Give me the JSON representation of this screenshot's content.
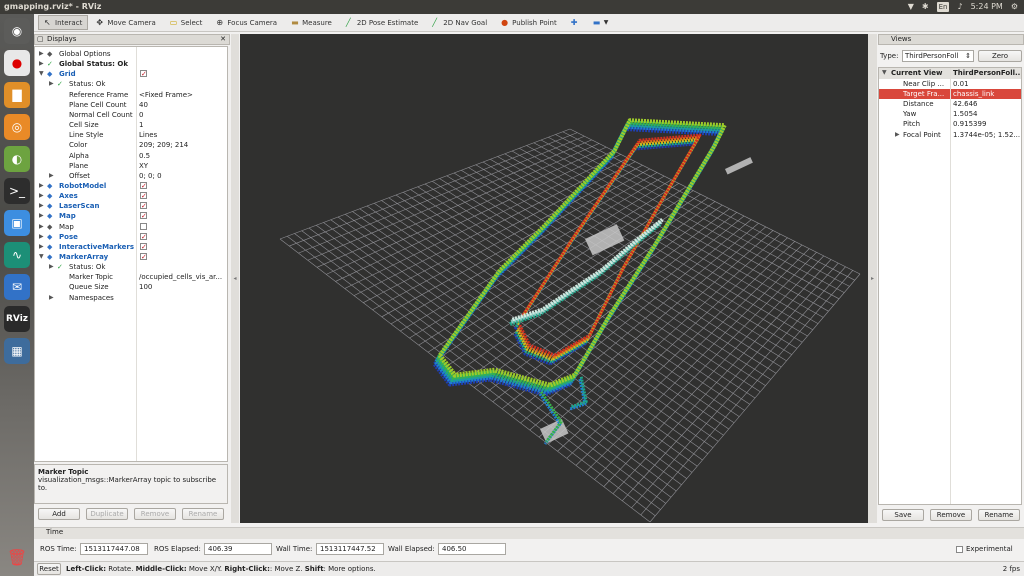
{
  "window": {
    "title": "gmapping.rviz* - RViz"
  },
  "tray": {
    "keyboard": "En",
    "time": "5:24 PM"
  },
  "toolbar": {
    "tools": [
      {
        "label": "Interact",
        "icon": "cursor-icon"
      },
      {
        "label": "Move Camera",
        "icon": "move-icon"
      },
      {
        "label": "Select",
        "icon": "select-icon"
      },
      {
        "label": "Focus Camera",
        "icon": "focus-icon"
      },
      {
        "label": "Measure",
        "icon": "ruler-icon"
      },
      {
        "label": "2D Pose Estimate",
        "icon": "green-arrow-icon"
      },
      {
        "label": "2D Nav Goal",
        "icon": "green-arrow-icon"
      },
      {
        "label": "Publish Point",
        "icon": "pin-icon"
      }
    ]
  },
  "displays": {
    "title": "Displays",
    "rows": [
      {
        "key": "Global Options",
        "val": "",
        "indent": 0,
        "style": "normal",
        "check": null,
        "arrow": "▶"
      },
      {
        "key": "Global Status: Ok",
        "val": "",
        "indent": 0,
        "style": "bold",
        "check": null,
        "arrow": "▶"
      },
      {
        "key": "Grid",
        "val": "",
        "indent": 0,
        "style": "blue",
        "check": true,
        "arrow": "▼"
      },
      {
        "key": "Status: Ok",
        "val": "",
        "indent": 1,
        "style": "normal",
        "check": null,
        "arrow": "▶"
      },
      {
        "key": "Reference Frame",
        "val": "<Fixed Frame>",
        "indent": 1,
        "style": "normal",
        "check": null,
        "arrow": ""
      },
      {
        "key": "Plane Cell Count",
        "val": "40",
        "indent": 1,
        "style": "normal",
        "check": null,
        "arrow": ""
      },
      {
        "key": "Normal Cell Count",
        "val": "0",
        "indent": 1,
        "style": "normal",
        "check": null,
        "arrow": ""
      },
      {
        "key": "Cell Size",
        "val": "1",
        "indent": 1,
        "style": "normal",
        "check": null,
        "arrow": ""
      },
      {
        "key": "Line Style",
        "val": "Lines",
        "indent": 1,
        "style": "normal",
        "check": null,
        "arrow": ""
      },
      {
        "key": "Color",
        "val": "209; 209; 214",
        "indent": 1,
        "style": "normal",
        "check": null,
        "arrow": ""
      },
      {
        "key": "Alpha",
        "val": "0.5",
        "indent": 1,
        "style": "normal",
        "check": null,
        "arrow": ""
      },
      {
        "key": "Plane",
        "val": "XY",
        "indent": 1,
        "style": "normal",
        "check": null,
        "arrow": ""
      },
      {
        "key": "Offset",
        "val": "0; 0; 0",
        "indent": 1,
        "style": "normal",
        "check": null,
        "arrow": "▶"
      },
      {
        "key": "RobotModel",
        "val": "",
        "indent": 0,
        "style": "blue",
        "check": true,
        "arrow": "▶"
      },
      {
        "key": "Axes",
        "val": "",
        "indent": 0,
        "style": "blue",
        "check": true,
        "arrow": "▶"
      },
      {
        "key": "LaserScan",
        "val": "",
        "indent": 0,
        "style": "blue",
        "check": true,
        "arrow": "▶"
      },
      {
        "key": "Map",
        "val": "",
        "indent": 0,
        "style": "blue",
        "check": true,
        "arrow": "▶"
      },
      {
        "key": "Map",
        "val": "",
        "indent": 0,
        "style": "normal",
        "check": false,
        "arrow": "▶"
      },
      {
        "key": "Pose",
        "val": "",
        "indent": 0,
        "style": "blue",
        "check": true,
        "arrow": "▶"
      },
      {
        "key": "InteractiveMarkers",
        "val": "",
        "indent": 0,
        "style": "blue",
        "check": true,
        "arrow": "▶"
      },
      {
        "key": "MarkerArray",
        "val": "",
        "indent": 0,
        "style": "blue",
        "check": true,
        "arrow": "▼"
      },
      {
        "key": "Status: Ok",
        "val": "",
        "indent": 1,
        "style": "normal",
        "check": null,
        "arrow": "▶"
      },
      {
        "key": "Marker Topic",
        "val": "/occupied_cells_vis_ar...",
        "indent": 1,
        "style": "normal",
        "check": null,
        "arrow": ""
      },
      {
        "key": "Queue Size",
        "val": "100",
        "indent": 1,
        "style": "normal",
        "check": null,
        "arrow": ""
      },
      {
        "key": "Namespaces",
        "val": "",
        "indent": 1,
        "style": "normal",
        "check": null,
        "arrow": "▶"
      }
    ],
    "desc_title": "Marker Topic",
    "desc_text": "visualization_msgs::MarkerArray topic to subscribe to.",
    "buttons": {
      "add": "Add",
      "duplicate": "Duplicate",
      "remove": "Remove",
      "rename": "Rename"
    }
  },
  "views": {
    "title": "Views",
    "type_label": "Type:",
    "type_value": "ThirdPersonFoll",
    "zero": "Zero",
    "header_key": "Current View",
    "header_val": "ThirdPersonFoll...",
    "rows": [
      {
        "key": "Near Clip ...",
        "val": "0.01",
        "selected": false,
        "arrow": ""
      },
      {
        "key": "Target Fra...",
        "val": "chassis_link",
        "selected": true,
        "arrow": ""
      },
      {
        "key": "Distance",
        "val": "42.646",
        "selected": false,
        "arrow": ""
      },
      {
        "key": "Yaw",
        "val": "1.5054",
        "selected": false,
        "arrow": ""
      },
      {
        "key": "Pitch",
        "val": "0.915399",
        "selected": false,
        "arrow": ""
      },
      {
        "key": "Focal Point",
        "val": "1.3744e-05; 1.52...",
        "selected": false,
        "arrow": "▶"
      }
    ],
    "buttons": {
      "save": "Save",
      "remove": "Remove",
      "rename": "Rename"
    }
  },
  "time": {
    "title": "Time",
    "ros_time_label": "ROS Time:",
    "ros_time": "1513117447.08",
    "ros_elapsed_label": "ROS Elapsed:",
    "ros_elapsed": "406.39",
    "wall_time_label": "Wall Time:",
    "wall_time": "1513117447.52",
    "wall_elapsed_label": "Wall Elapsed:",
    "wall_elapsed": "406.50",
    "experimental": "Experimental"
  },
  "status": {
    "reset": "Reset",
    "left_click": "Left-Click:",
    "left_text": " Rotate. ",
    "middle_click": "Middle-Click:",
    "middle_text": " Move X/Y. ",
    "right_click": "Right-Click:",
    "right_text": ": Move Z. ",
    "shift": "Shift",
    "shift_text": ": More options.",
    "fps": "2 fps"
  },
  "colors": {
    "accent": "#dd4814",
    "selected_row": "#d9473b",
    "viewport_bg": "#30302f",
    "grid": "#a7a7ae"
  }
}
